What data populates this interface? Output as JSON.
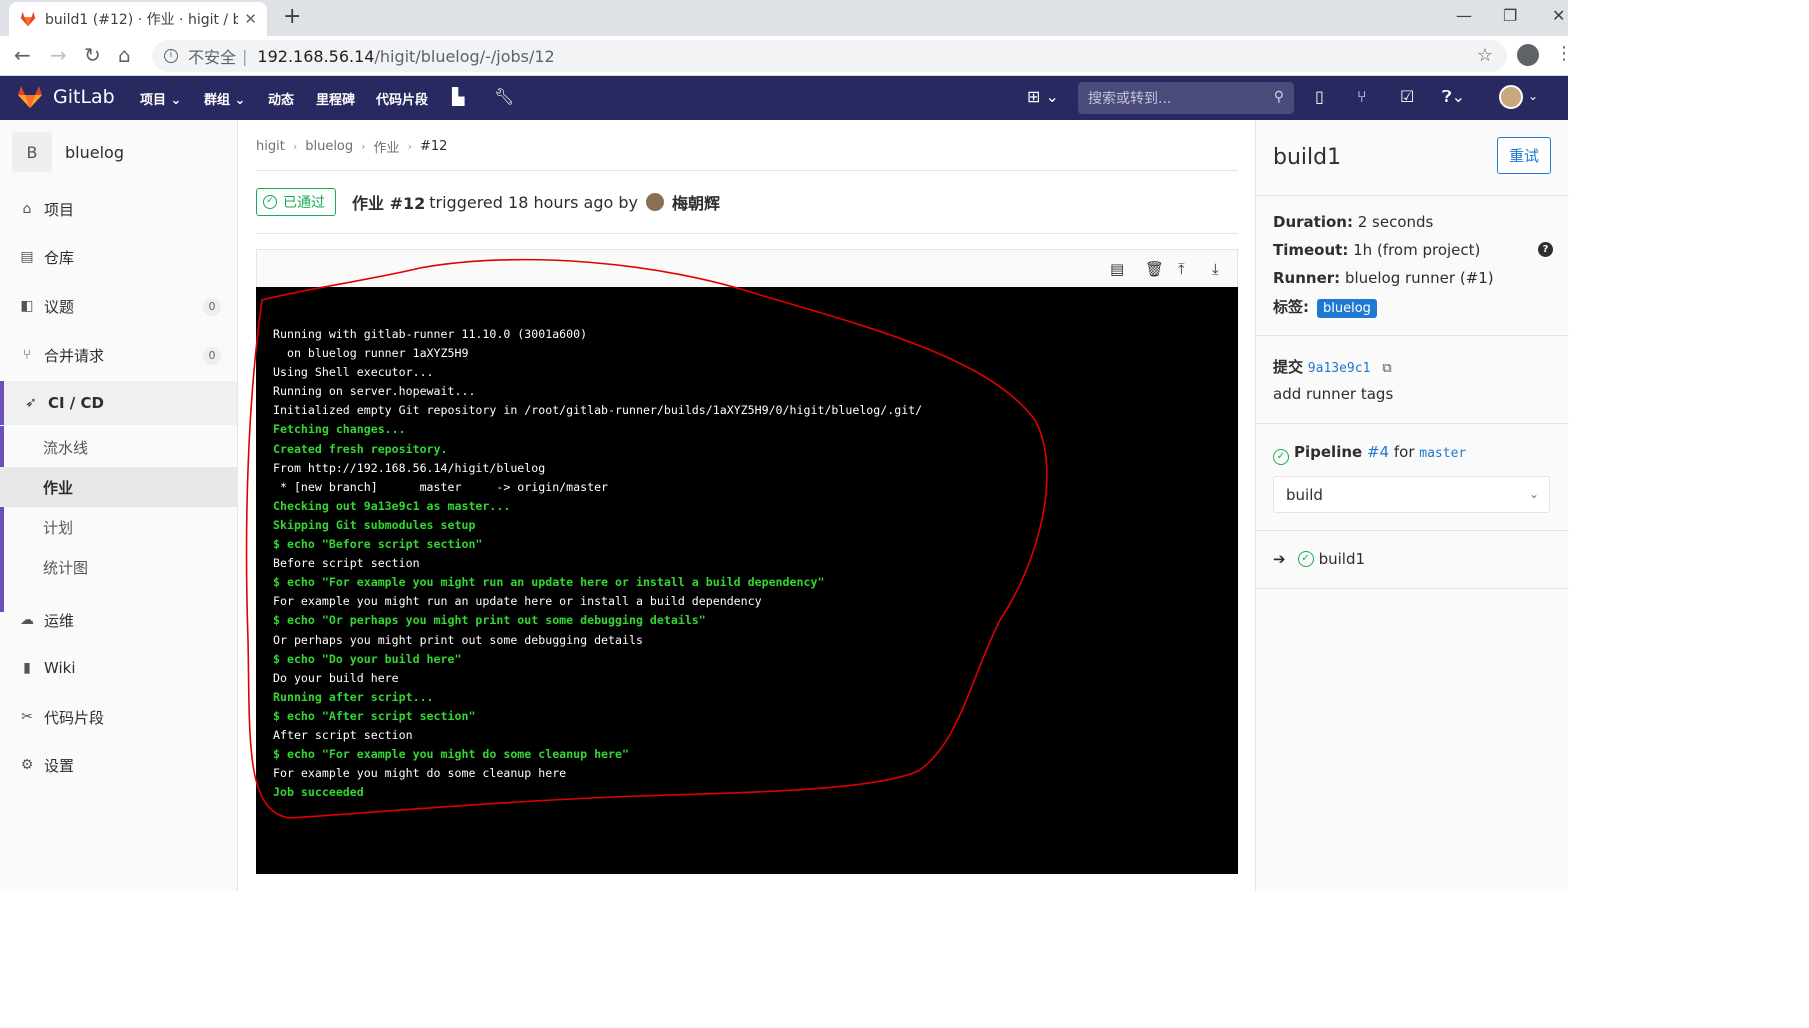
{
  "browser": {
    "tab_title": "build1 (#12) · 作业 · higit / blue",
    "tab_close": "✕",
    "new_tab": "+",
    "address_insecure": "不安全",
    "address_sep": "|",
    "address_host": "192.168.56.14",
    "address_path": "/higit/bluelog/-/jobs/12",
    "win_min": "—",
    "win_max": "❐",
    "win_close": "✕"
  },
  "gitlab_nav": {
    "brand": "GitLab",
    "items": [
      "项目",
      "群组",
      "动态",
      "里程碑",
      "代码片段"
    ],
    "search_placeholder": "搜索或转到..."
  },
  "sidebar": {
    "project_initial": "B",
    "project_name": "bluelog",
    "items": [
      {
        "label": "项目",
        "icon": "home-icon"
      },
      {
        "label": "仓库",
        "icon": "doc-icon"
      },
      {
        "label": "议题",
        "icon": "issues-icon",
        "count": "0"
      },
      {
        "label": "合并请求",
        "icon": "merge-icon",
        "count": "0"
      },
      {
        "label": "CI / CD",
        "icon": "rocket-icon"
      },
      {
        "label": "运维",
        "icon": "cloud-icon"
      },
      {
        "label": "Wiki",
        "icon": "book-icon"
      },
      {
        "label": "代码片段",
        "icon": "scissors-icon"
      },
      {
        "label": "设置",
        "icon": "gear-icon"
      }
    ],
    "cicd_sub": [
      "流水线",
      "作业",
      "计划",
      "统计图"
    ]
  },
  "breadcrumb": [
    "higit",
    "bluelog",
    "作业",
    "#12"
  ],
  "job_header": {
    "status": "已通过",
    "job": "作业 #12",
    "triggered": "triggered 18 hours ago by",
    "user": "梅朝辉"
  },
  "log_lines": [
    {
      "t": "Running with gitlab-runner 11.10.0 (3001a600)",
      "g": false
    },
    {
      "t": "  on bluelog runner 1aXYZ5H9",
      "g": false
    },
    {
      "t": "Using Shell executor...",
      "g": false
    },
    {
      "t": "Running on server.hopewait...",
      "g": false
    },
    {
      "t": "Initialized empty Git repository in /root/gitlab-runner/builds/1aXYZ5H9/0/higit/bluelog/.git/",
      "g": false
    },
    {
      "t": "Fetching changes...",
      "g": true
    },
    {
      "t": "Created fresh repository.",
      "g": true
    },
    {
      "t": "From http://192.168.56.14/higit/bluelog",
      "g": false
    },
    {
      "t": " * [new branch]      master     -> origin/master",
      "g": false
    },
    {
      "t": "Checking out 9a13e9c1 as master...",
      "g": true
    },
    {
      "t": "Skipping Git submodules setup",
      "g": true
    },
    {
      "t": "$ echo \"Before script section\"",
      "g": true
    },
    {
      "t": "Before script section",
      "g": false
    },
    {
      "t": "$ echo \"For example you might run an update here or install a build dependency\"",
      "g": true
    },
    {
      "t": "For example you might run an update here or install a build dependency",
      "g": false
    },
    {
      "t": "$ echo \"Or perhaps you might print out some debugging details\"",
      "g": true
    },
    {
      "t": "Or perhaps you might print out some debugging details",
      "g": false
    },
    {
      "t": "$ echo \"Do your build here\"",
      "g": true
    },
    {
      "t": "Do your build here",
      "g": false
    },
    {
      "t": "Running after script...",
      "g": true
    },
    {
      "t": "$ echo \"After script section\"",
      "g": true
    },
    {
      "t": "After script section",
      "g": false
    },
    {
      "t": "$ echo \"For example you might do some cleanup here\"",
      "g": true
    },
    {
      "t": "For example you might do some cleanup here",
      "g": false
    },
    {
      "t": "Job succeeded",
      "g": true
    }
  ],
  "right_panel": {
    "title": "build1",
    "retry": "重试",
    "duration_label": "Duration:",
    "duration_value": "2 seconds",
    "timeout_label": "Timeout:",
    "timeout_value": "1h (from project)",
    "runner_label": "Runner:",
    "runner_value": "bluelog runner (#1)",
    "tags_label": "标签:",
    "tag": "bluelog",
    "commit_label": "提交",
    "commit_sha": "9a13e9c1",
    "commit_msg": "add runner tags",
    "pipeline_label": "Pipeline",
    "pipeline_id": "#4",
    "pipeline_for": "for",
    "pipeline_branch": "master",
    "stage": "build",
    "job": "build1"
  },
  "colors": {
    "nav_bg": "#292961",
    "accent": "#1f78d1",
    "success": "#1aaa55",
    "log_green": "#33d633",
    "annotation": "#e00000"
  }
}
